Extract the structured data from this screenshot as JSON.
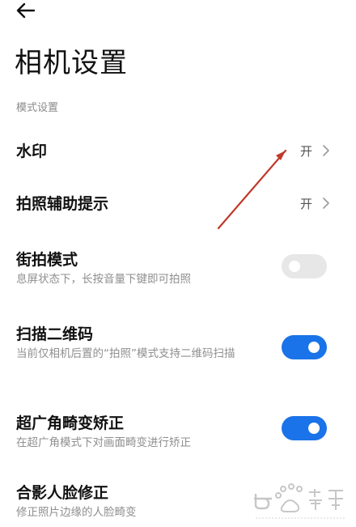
{
  "header": {
    "back_icon": "arrow-left-icon",
    "title": "相机设置"
  },
  "sections": [
    {
      "header": "模式设置"
    }
  ],
  "rows": {
    "watermark": {
      "title": "水印",
      "value": "开"
    },
    "shooting_hints": {
      "title": "拍照辅助提示",
      "value": "开"
    },
    "street_mode": {
      "title": "街拍模式",
      "desc": "息屏状态下，长按音量下键即可拍照",
      "toggle": false
    },
    "qr_scan": {
      "title": "扫描二维码",
      "desc": "当前仅相机后置的“拍照”模式支持二维码扫描",
      "toggle": true
    },
    "ultrawide_correction": {
      "title": "超广角畸变矫正",
      "desc": "在超广角模式下对画面畸变进行矫正",
      "toggle": true
    },
    "group_face_correction": {
      "title": "合影人脸修正",
      "desc": "修正照片边缘的人脸畸变"
    }
  },
  "colors": {
    "accent": "#1a73e8",
    "toggle_off": "#e7e7e7",
    "annotation_arrow": "#c0392b"
  },
  "watermark_logo": "Baidu 经验 jingyan.baidu.com"
}
